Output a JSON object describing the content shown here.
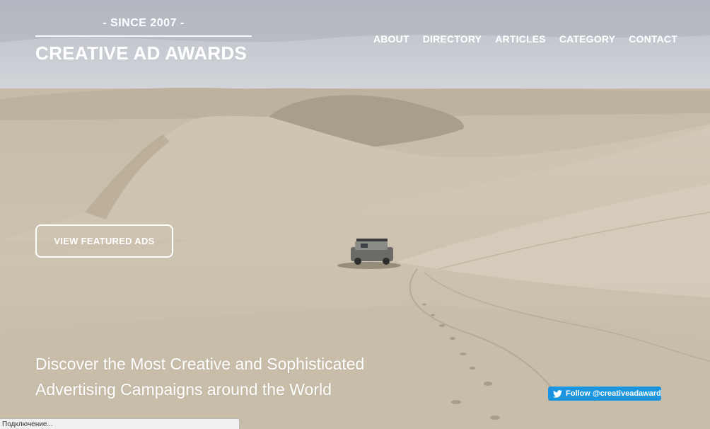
{
  "brand": {
    "since": "- SINCE 2007 -",
    "title": "CREATIVE AD AWARDS"
  },
  "nav": {
    "items": [
      {
        "label": "ABOUT"
      },
      {
        "label": "DIRECTORY"
      },
      {
        "label": "ARTICLES"
      },
      {
        "label": "CATEGORY"
      },
      {
        "label": "CONTACT"
      }
    ]
  },
  "hero": {
    "cta_label": "VIEW FEATURED ADS",
    "tagline_line1": "Discover the Most Creative and Sophisticated",
    "tagline_line2": "Advertising Campaigns around the World"
  },
  "twitter": {
    "follow_label": "Follow @creativeadaward"
  },
  "status_bar": {
    "text": "Подключение..."
  },
  "colors": {
    "twitter_blue": "#1b95e0",
    "sand": "#c9bfad",
    "sky": "#c3c8cf"
  },
  "icons": {
    "twitter": "twitter-bird-icon"
  }
}
